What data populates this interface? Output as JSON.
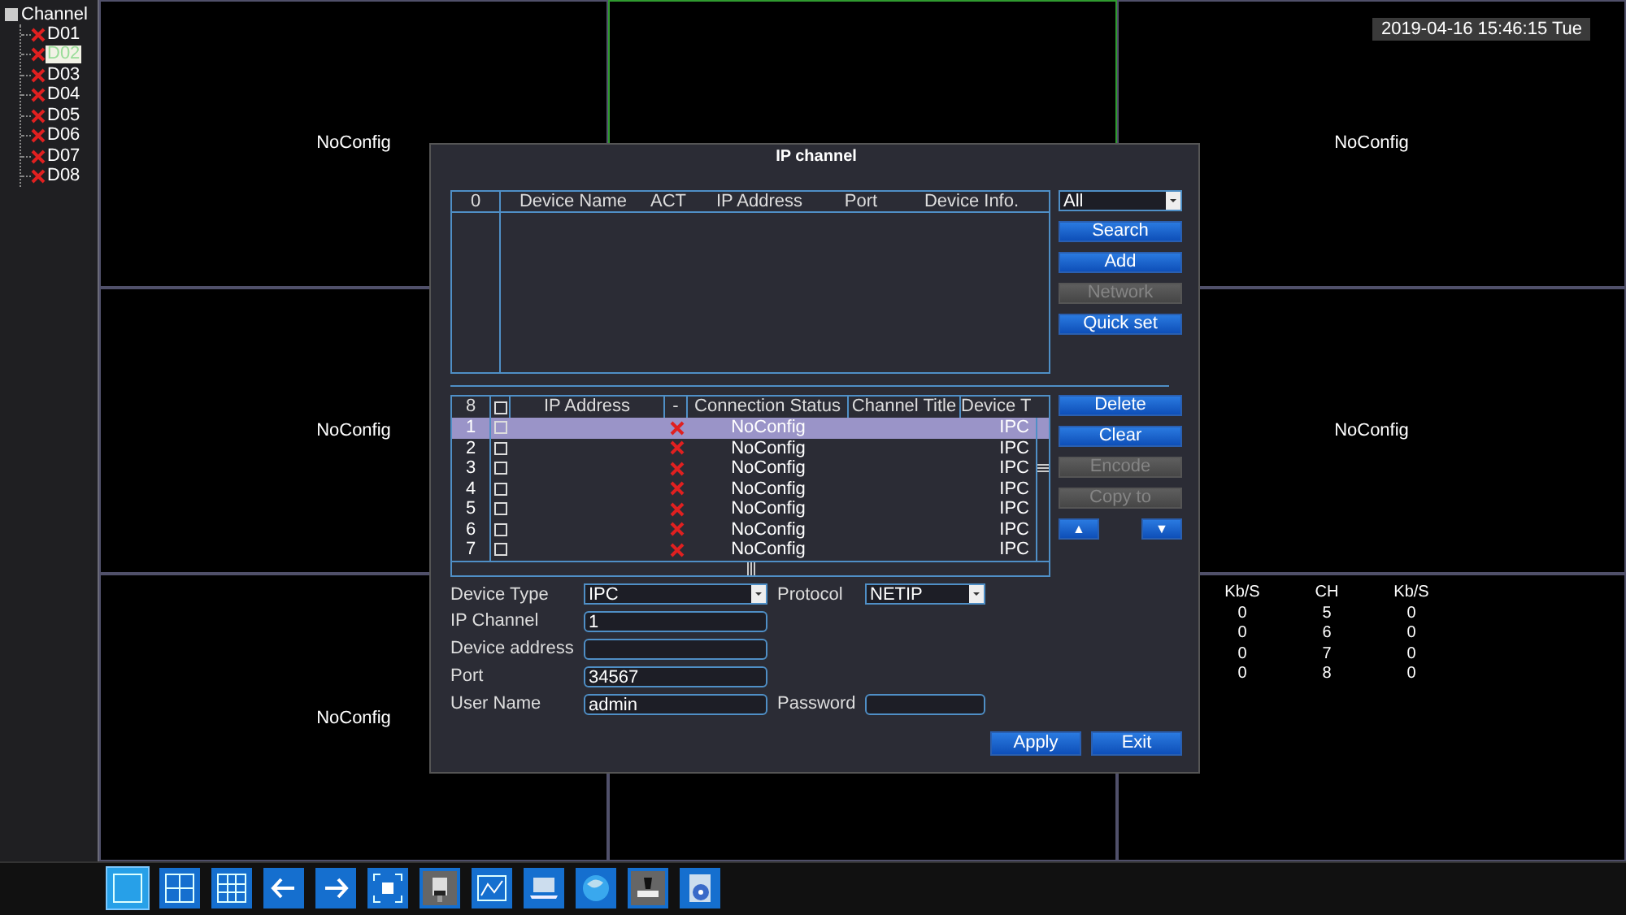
{
  "sidebar": {
    "title": "Channel",
    "expanded": true,
    "items": [
      {
        "label": "D01",
        "selected": false
      },
      {
        "label": "D02",
        "selected": true
      },
      {
        "label": "D03",
        "selected": false
      },
      {
        "label": "D04",
        "selected": false
      },
      {
        "label": "D05",
        "selected": false
      },
      {
        "label": "D06",
        "selected": false
      },
      {
        "label": "D07",
        "selected": false
      },
      {
        "label": "D08",
        "selected": false
      }
    ]
  },
  "timestamp": "2019-04-16 15:46:15 Tue",
  "grid": {
    "cells": [
      {
        "kind": "label",
        "text": "NoConfig",
        "selected": false
      },
      {
        "kind": "empty",
        "selected": true
      },
      {
        "kind": "label",
        "text": "NoConfig",
        "selected": false
      },
      {
        "kind": "label",
        "text": "NoConfig",
        "selected": false
      },
      {
        "kind": "empty"
      },
      {
        "kind": "label",
        "text": "NoConfig",
        "selected": false
      },
      {
        "kind": "label",
        "text": "NoConfig",
        "selected": false
      },
      {
        "kind": "empty",
        "selected": false
      },
      {
        "kind": "stats",
        "selected": false
      }
    ]
  },
  "stats": {
    "columns": [
      "Kb/S",
      "CH",
      "Kb/S"
    ],
    "rows": [
      [
        "0",
        "5",
        "0"
      ],
      [
        "0",
        "6",
        "0"
      ],
      [
        "0",
        "7",
        "0"
      ],
      [
        "0",
        "8",
        "0"
      ]
    ]
  },
  "dialog": {
    "title": "IP channel",
    "search_table": {
      "columns": [
        "0",
        "Device Name",
        "ACT",
        "IP Address",
        "Port",
        "Device Info."
      ]
    },
    "filter": "All",
    "search_buttons": [
      {
        "label": "Search",
        "disabled": false
      },
      {
        "label": "Add",
        "disabled": false
      },
      {
        "label": "Network",
        "disabled": true
      },
      {
        "label": "Quick set",
        "disabled": false
      }
    ],
    "channel_table": {
      "columns": [
        "8",
        "",
        "IP Address",
        "-",
        "Connection Status",
        "Channel Title",
        "Device T"
      ],
      "all_checked": false,
      "rows": [
        {
          "index": "1",
          "checked": false,
          "selected": true,
          "status": "NoConfig",
          "device_type": "IPC"
        },
        {
          "index": "2",
          "checked": false,
          "selected": false,
          "status": "NoConfig",
          "device_type": "IPC"
        },
        {
          "index": "3",
          "checked": false,
          "selected": false,
          "status": "NoConfig",
          "device_type": "IPC"
        },
        {
          "index": "4",
          "checked": false,
          "selected": false,
          "status": "NoConfig",
          "device_type": "IPC"
        },
        {
          "index": "5",
          "checked": false,
          "selected": false,
          "status": "NoConfig",
          "device_type": "IPC"
        },
        {
          "index": "6",
          "checked": false,
          "selected": false,
          "status": "NoConfig",
          "device_type": "IPC"
        },
        {
          "index": "7",
          "checked": false,
          "selected": false,
          "status": "NoConfig",
          "device_type": "IPC"
        }
      ]
    },
    "channel_buttons": [
      {
        "label": "Delete",
        "disabled": false
      },
      {
        "label": "Clear",
        "disabled": false
      },
      {
        "label": "Encode",
        "disabled": true
      },
      {
        "label": "Copy to",
        "disabled": true
      }
    ],
    "arrows": [
      "▲",
      "▼"
    ],
    "form": {
      "device_type": {
        "label": "Device Type",
        "value": "IPC"
      },
      "protocol": {
        "label": "Protocol",
        "value": "NETIP"
      },
      "ip_channel": {
        "label": "IP Channel",
        "value": "1"
      },
      "device_address": {
        "label": "Device address"
      },
      "port": {
        "label": "Port",
        "value": "34567"
      },
      "user_name": {
        "label": "User Name",
        "value": "admin"
      },
      "password": {
        "label": "Password"
      }
    },
    "actions": [
      "Apply",
      "Exit"
    ]
  },
  "toolbar": [
    {
      "kind": "single",
      "selected": true
    },
    {
      "kind": "quad",
      "selected": false
    },
    {
      "kind": "nine",
      "selected": false
    },
    {
      "kind": "prev",
      "selected": false
    },
    {
      "kind": "next",
      "selected": false
    },
    {
      "kind": "full",
      "selected": false
    },
    {
      "kind": "camera",
      "selected": false
    },
    {
      "kind": "chart",
      "selected": false
    },
    {
      "kind": "laptop",
      "selected": false
    },
    {
      "kind": "globe",
      "selected": false
    },
    {
      "kind": "stamp",
      "selected": false
    },
    {
      "kind": "disc",
      "selected": false
    }
  ]
}
